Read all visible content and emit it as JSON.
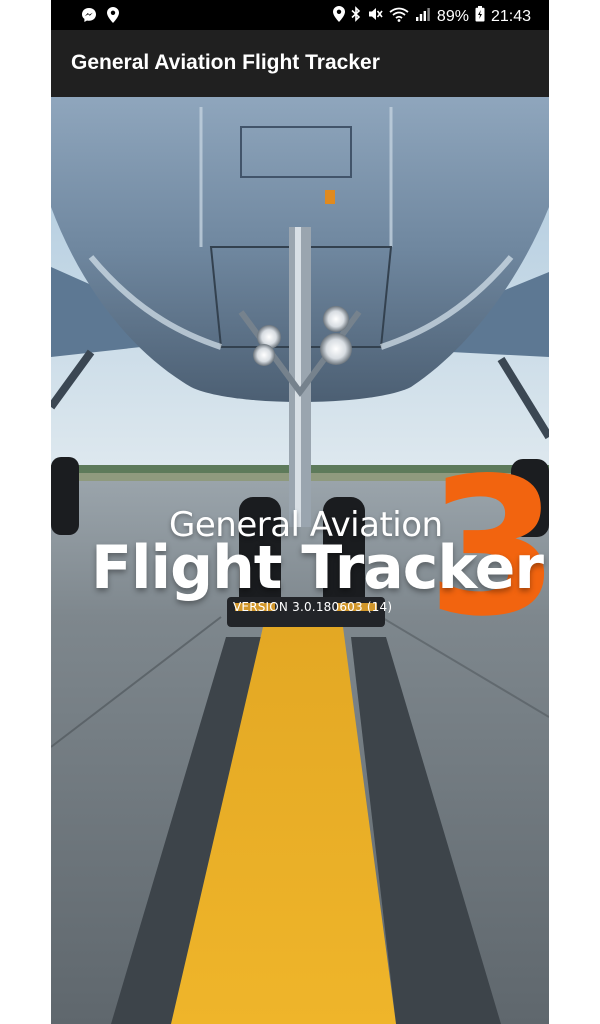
{
  "status_bar": {
    "left_icons": [
      "messenger-icon",
      "location-icon"
    ],
    "right_icons": [
      "location-icon",
      "bluetooth-icon",
      "mute-icon",
      "wifi-icon",
      "signal-icon",
      "battery-icon"
    ],
    "battery": "89%",
    "time": "21:43"
  },
  "app_bar": {
    "title": "General Aviation Flight Tracker"
  },
  "splash": {
    "line1": "General Aviation",
    "line2": "Flight Tracker",
    "number": "3",
    "version": "VERSION 3.0.180603 (14)",
    "accent_color": "#f2640f"
  }
}
